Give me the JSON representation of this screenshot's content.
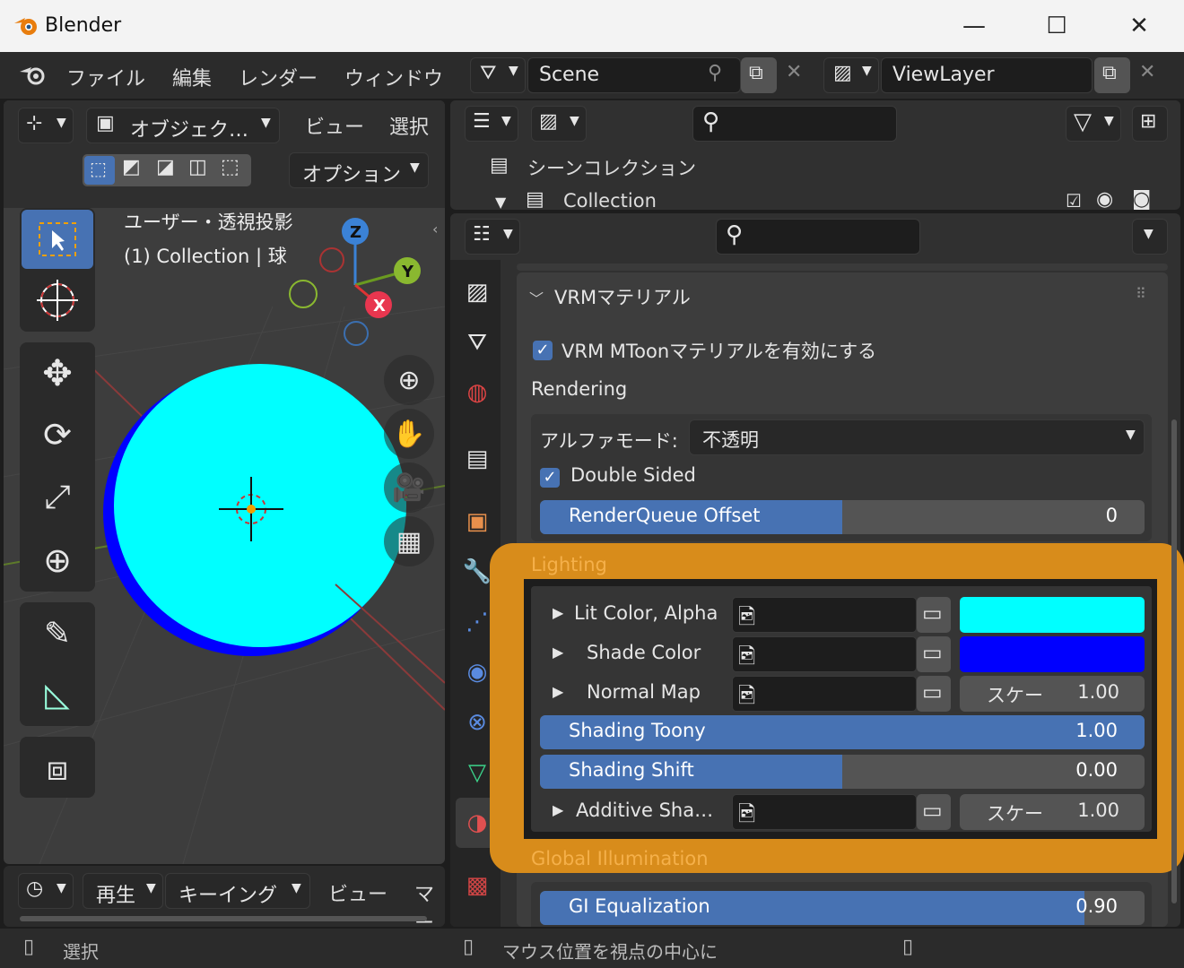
{
  "window": {
    "title": "Blender",
    "minimize": "—",
    "maximize": "☐",
    "close": "✕"
  },
  "menubar": {
    "file": "ファイル",
    "edit": "編集",
    "render": "レンダー",
    "window": "ウィンドウ"
  },
  "scene": {
    "name": "Scene"
  },
  "viewlayer": {
    "name": "ViewLayer"
  },
  "viewport": {
    "mode": "オブジェク…",
    "view": "ビュー",
    "select": "選択",
    "options": "オプション",
    "info_line1": "ユーザー・透視投影",
    "info_line2": "(1) Collection | 球",
    "axis_z": "Z",
    "axis_y": "Y",
    "axis_x": "X"
  },
  "timeline": {
    "play": "再生",
    "keying": "キーイング",
    "view": "ビュー",
    "marker": "マー"
  },
  "outliner": {
    "scene_collection": "シーンコレクション",
    "collection": "Collection"
  },
  "properties": {
    "panel_title": "VRMマテリアル",
    "enable_mtoon": "VRM MToonマテリアルを有効にする",
    "rendering_header": "Rendering",
    "alpha_mode_label": "アルファモード:",
    "alpha_mode_value": "不透明",
    "double_sided": "Double Sided",
    "render_queue": {
      "label": "RenderQueue Offset",
      "value": "0",
      "fraction": 0.5
    },
    "lighting_header": "Lighting",
    "lit_color": "Lit Color, Alpha",
    "shade_color": "Shade Color",
    "normal_map": "Normal Map",
    "normal_scale_label": "スケー",
    "normal_scale_value": "1.00",
    "shading_toony": {
      "label": "Shading Toony",
      "value": "1.00",
      "fraction": 1.0
    },
    "shading_shift": {
      "label": "Shading Shift",
      "value": "0.00",
      "fraction": 0.5
    },
    "additive": "Additive Sha…",
    "additive_scale_label": "スケー",
    "additive_scale_value": "1.00",
    "gi_header": "Global Illumination",
    "gi_equalization": {
      "label": "GI Equalization",
      "value": "0.90",
      "fraction": 0.9
    }
  },
  "colors": {
    "lit": "#00ffff",
    "shade": "#0000ff",
    "highlight": "#d88c1b",
    "accent": "#4772b3"
  },
  "status": {
    "select": "選択",
    "center": "マウス位置を視点の中心に"
  }
}
